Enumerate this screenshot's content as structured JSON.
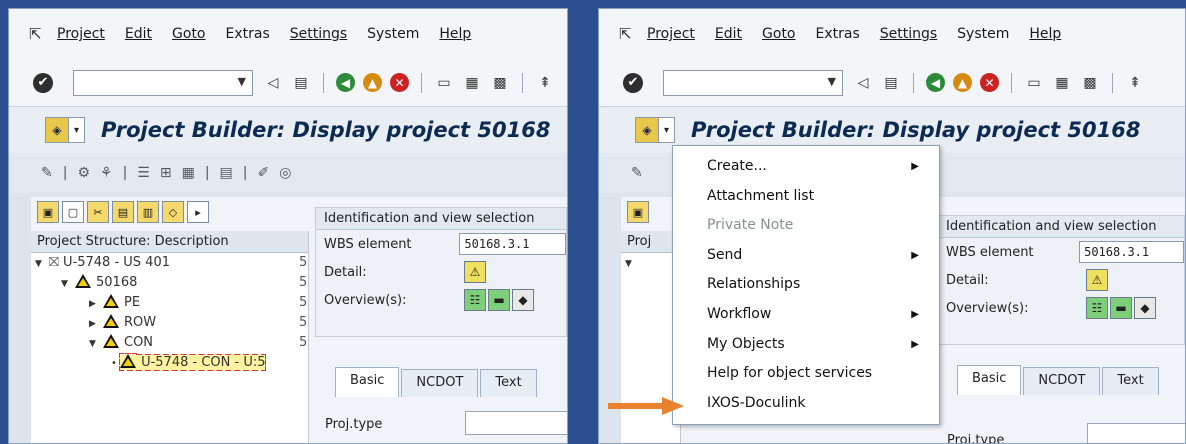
{
  "menubar": {
    "items": [
      "Project",
      "Edit",
      "Goto",
      "Extras",
      "Settings",
      "System",
      "Help"
    ]
  },
  "header": {
    "title": "Project Builder: Display project 50168"
  },
  "left_panel": {
    "tree_header": "Project Structure: Description",
    "tree": [
      {
        "label": "U-5748 - US 401",
        "col": "5"
      },
      {
        "label": "50168",
        "col": "5"
      },
      {
        "label": "PE",
        "col": "5"
      },
      {
        "label": "ROW",
        "col": "5"
      },
      {
        "label": "CON",
        "col": "5"
      },
      {
        "label": "U-5748 - CON - U:5",
        "col": ""
      }
    ]
  },
  "ident": {
    "heading": "Identification and view selection",
    "wbs_label": "WBS element",
    "wbs_value": "50168.3.1",
    "detail_label": "Detail:",
    "overview_label": "Overview(s):"
  },
  "tabs": [
    "Basic",
    "NCDOT",
    "Text"
  ],
  "proj_type_label": "Proj.type",
  "right_panel": {
    "tree_header_stub": "Proj"
  },
  "context_menu": {
    "items": [
      {
        "label": "Create...",
        "submenu": true,
        "disabled": false
      },
      {
        "label": "Attachment list",
        "submenu": false,
        "disabled": false
      },
      {
        "label": "Private Note",
        "submenu": false,
        "disabled": true
      },
      {
        "label": "Send",
        "submenu": true,
        "disabled": false
      },
      {
        "label": "Relationships",
        "submenu": false,
        "disabled": false
      },
      {
        "label": "Workflow",
        "submenu": true,
        "disabled": false
      },
      {
        "label": "My Objects",
        "submenu": true,
        "disabled": false
      },
      {
        "label": "Help for object services",
        "submenu": false,
        "disabled": false
      },
      {
        "label": "IXOS-Doculink",
        "submenu": false,
        "disabled": false
      }
    ]
  },
  "colors": {
    "frame": "#2c4f8f",
    "arrow": "#e9812e",
    "title": "#0d2a52"
  }
}
